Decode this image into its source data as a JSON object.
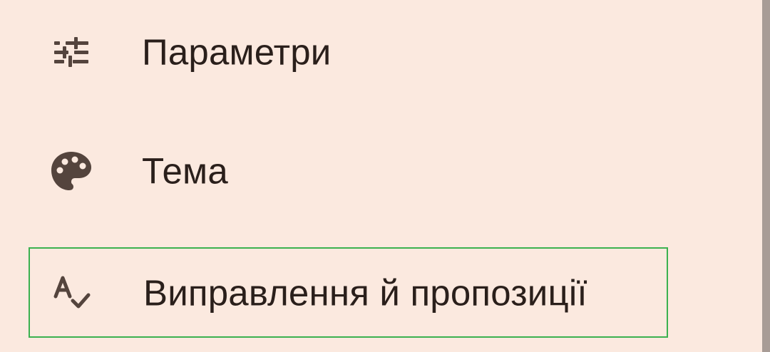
{
  "menu": {
    "items": [
      {
        "label": "Параметри",
        "icon": "tune-sliders-icon"
      },
      {
        "label": "Тема",
        "icon": "palette-icon"
      },
      {
        "label": "Виправлення й пропозиції",
        "icon": "spellcheck-icon"
      }
    ]
  },
  "colors": {
    "background": "#fbe9df",
    "text": "#2a1f1b",
    "icon": "#54443d",
    "highlight_border": "#3bb14f",
    "scrollbar": "#a89c96"
  }
}
